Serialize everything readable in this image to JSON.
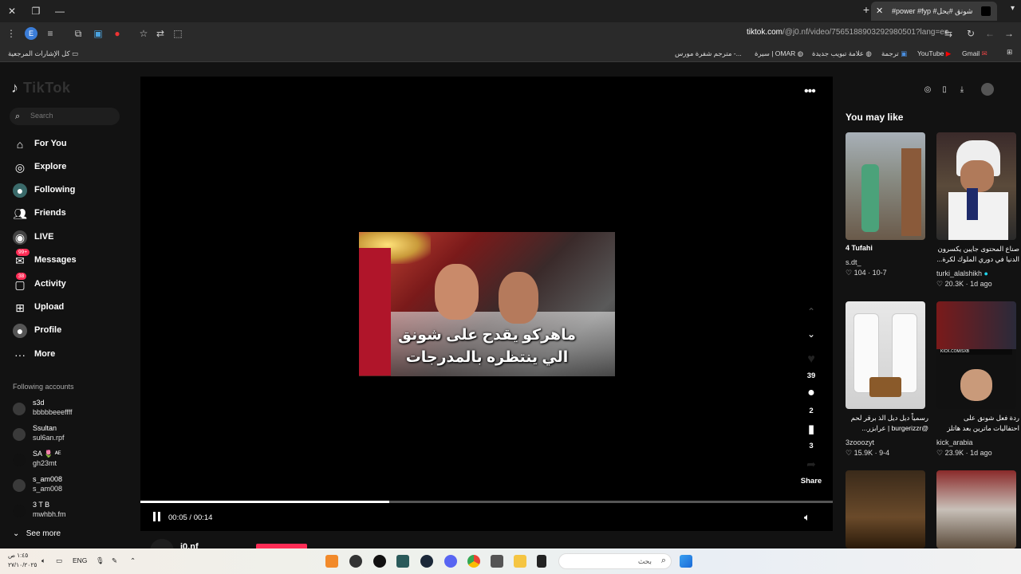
{
  "browser": {
    "tab_title": "#power #fyp #شونق #يحل",
    "url_host": "tiktok.com",
    "url_path": "/@j0.nf/video/7565188903292980501?lang=en",
    "bookmarks_left": "كل الإشارات المرجعية",
    "bookmarks": [
      "Gmail",
      "YouTube",
      "ترجمة",
      "علامة تبويب جديدة",
      "سيرة | OMAR",
      "مترجم شفرة مورس -..."
    ]
  },
  "sidebar": {
    "logo": "TikTok",
    "search_placeholder": "Search",
    "nav": [
      {
        "label": "For You",
        "icon": "home-icon"
      },
      {
        "label": "Explore",
        "icon": "compass-icon"
      },
      {
        "label": "Following",
        "icon": "following-avatar-icon"
      },
      {
        "label": "Friends",
        "icon": "friends-icon"
      },
      {
        "label": "LIVE",
        "icon": "live-icon"
      },
      {
        "label": "Messages",
        "icon": "messages-icon",
        "badge": "99+"
      },
      {
        "label": "Activity",
        "icon": "activity-icon",
        "badge": "38"
      },
      {
        "label": "Upload",
        "icon": "upload-icon"
      },
      {
        "label": "Profile",
        "icon": "profile-icon"
      },
      {
        "label": "More",
        "icon": "more-icon"
      }
    ],
    "following_title": "Following accounts",
    "accounts": [
      {
        "name": "s3d",
        "handle": "bbbbbeeeffff"
      },
      {
        "name": "Ssultan",
        "handle": "sul6an.rpf"
      },
      {
        "name": "SA 🌷 ᴬᴱ",
        "handle": "gh23mt"
      },
      {
        "name": "s_am008",
        "handle": "s_am008"
      },
      {
        "name": "3 T B",
        "handle": "mwhbh.fm"
      }
    ],
    "see_more": "See more"
  },
  "video": {
    "subtitle_line1": "ماهركو يقدح على شونق",
    "subtitle_line2": "الي ينتظره بالمدرجات",
    "likes": "39",
    "comments": "2",
    "saves": "3",
    "share": "Share",
    "current_time": "00:05",
    "duration": "00:14",
    "time_display": "00:05 / 00:14",
    "progress": 0.36,
    "author": "j0.nf"
  },
  "right_panel": {
    "title": "You may like",
    "cards": [
      {
        "title": "4 Tufahi",
        "author": "s.dt_",
        "likes": "104",
        "date": "10-7",
        "arabic": false
      },
      {
        "title": "صناع المحتوى جايين يكسرون الدنيا في دوري الملوك لكرة...",
        "author": "turki_alalshikh",
        "likes": "20.3K",
        "date": "1d ago",
        "arabic": true,
        "verified": true
      },
      {
        "title": "رسمياً ديل ديل الذ برقر لحم @burgerizzr | عرابزر...",
        "author": "3zooozyt",
        "likes": "15.9K",
        "date": "9-4",
        "arabic": true
      },
      {
        "title": "ردة فعل شونق على احتفاليات ماترين بعد هاتلز على الغرى...",
        "author": "kick_arabia",
        "likes": "23.9K",
        "date": "1d ago",
        "arabic": true
      }
    ]
  },
  "taskbar": {
    "search_placeholder": "بحث",
    "language": "ENG",
    "time": "١:٤٥ ص",
    "date": "٢٧/١٠/٢٠٢٥"
  },
  "colors": {
    "accent": "#fe2c55",
    "background": "#121212",
    "player": "#000000"
  }
}
